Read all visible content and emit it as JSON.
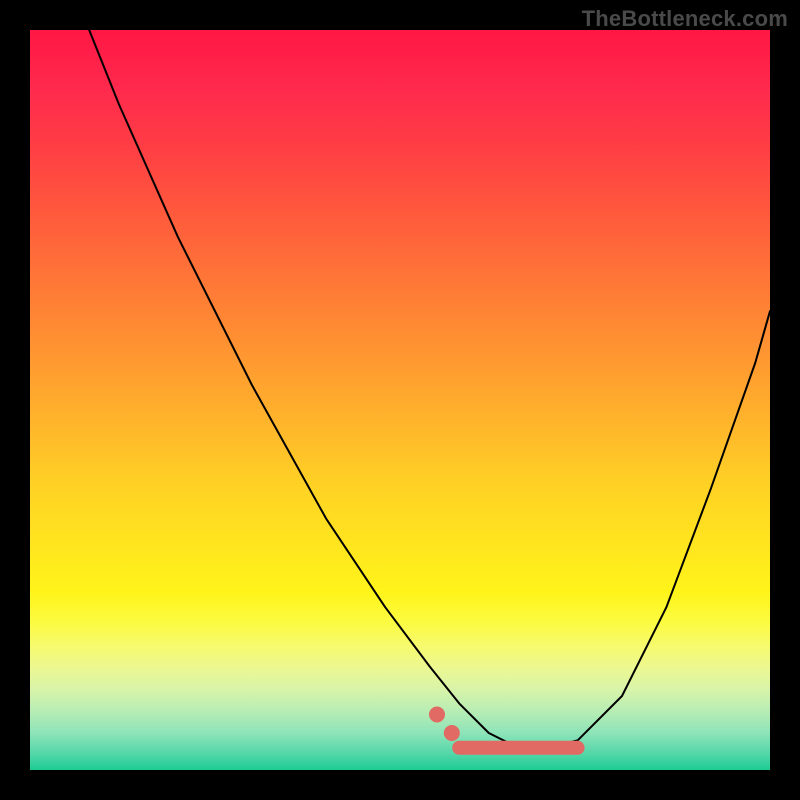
{
  "watermark": "TheBottleneck.com",
  "colors": {
    "page_bg": "#000000",
    "curve": "#000000",
    "marker": "#e26a64",
    "gradient_top": "#ff1744",
    "gradient_mid": "#ffe61e",
    "gradient_bottom": "#1ccc92"
  },
  "chart_data": {
    "type": "line",
    "title": "",
    "xlabel": "",
    "ylabel": "",
    "xlim": [
      0,
      100
    ],
    "ylim": [
      0,
      100
    ],
    "grid": false,
    "legend_position": "none",
    "series": [
      {
        "name": "curve",
        "x": [
          8,
          12,
          20,
          30,
          40,
          48,
          54,
          58,
          62,
          66,
          70,
          74,
          80,
          86,
          92,
          98,
          100
        ],
        "values": [
          100,
          90,
          72,
          52,
          34,
          22,
          14,
          9,
          5,
          3,
          3,
          4,
          10,
          22,
          38,
          55,
          62
        ]
      }
    ],
    "markers": {
      "segment": {
        "x": [
          58,
          74
        ],
        "y": [
          3,
          3
        ]
      },
      "dots": [
        {
          "x": 55,
          "y": 7.5
        },
        {
          "x": 57,
          "y": 5
        }
      ]
    },
    "background": "vertical-gradient red→yellow→green"
  }
}
